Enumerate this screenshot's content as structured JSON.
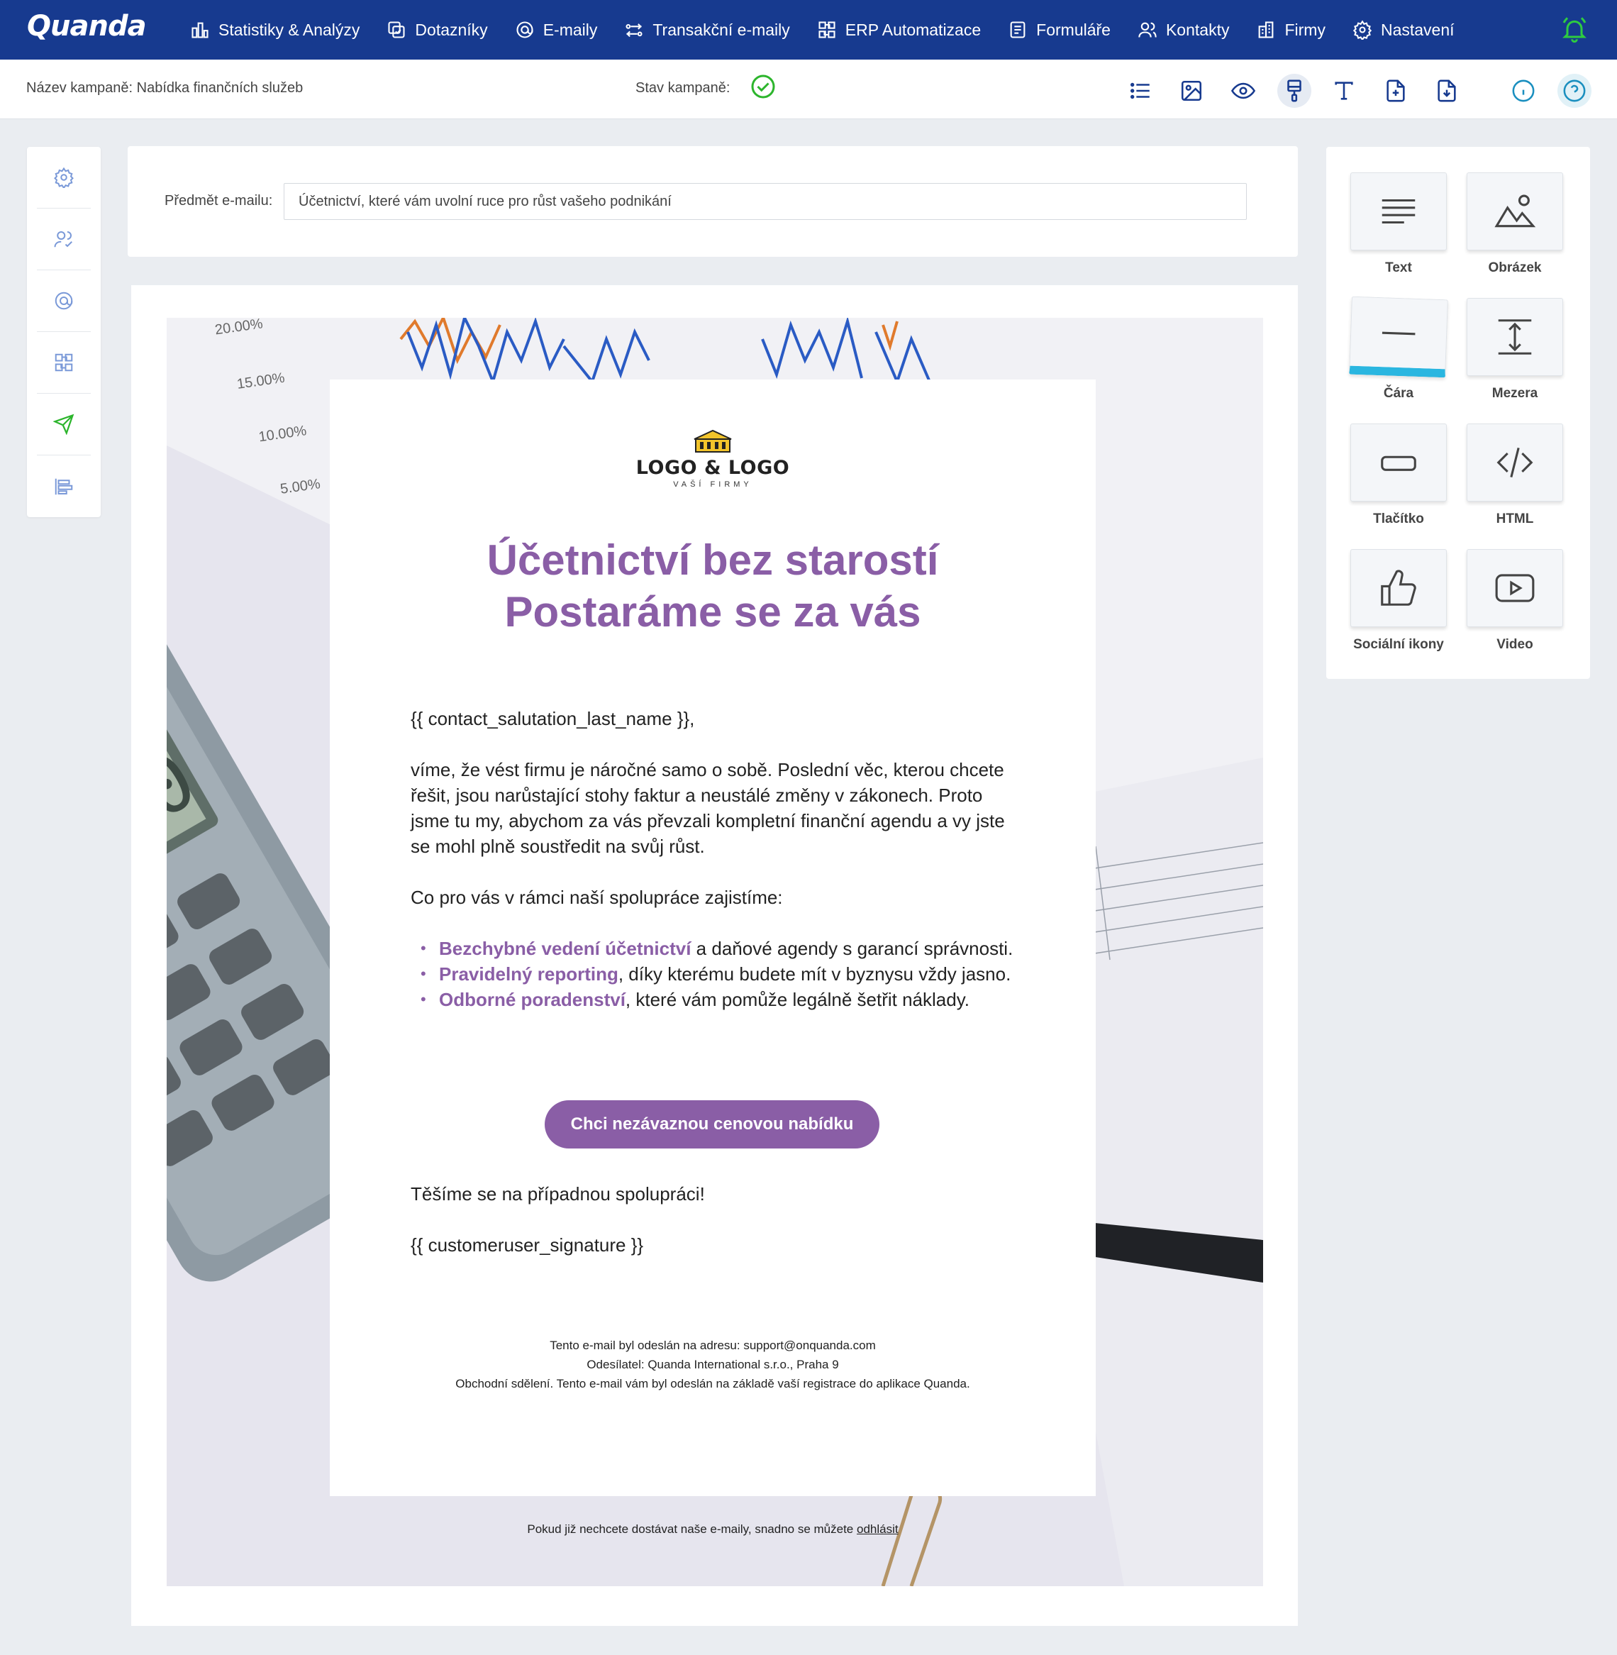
{
  "app": {
    "brand": "Quanda"
  },
  "nav": {
    "items": [
      {
        "label": "Statistiky & Analýzy",
        "icon": "bar-chart-icon"
      },
      {
        "label": "Dotazníky",
        "icon": "survey-icon"
      },
      {
        "label": "E-maily",
        "icon": "at-icon"
      },
      {
        "label": "Transakční e-maily",
        "icon": "transaction-icon"
      },
      {
        "label": "ERP Automatizace",
        "icon": "automation-icon"
      },
      {
        "label": "Formuláře",
        "icon": "form-icon"
      },
      {
        "label": "Kontakty",
        "icon": "contacts-icon"
      },
      {
        "label": "Firmy",
        "icon": "building-icon"
      },
      {
        "label": "Nastavení",
        "icon": "gear-icon"
      }
    ]
  },
  "campaign": {
    "name": "Název kampaně: Nabídka finančních služeb",
    "state_label": "Stav kampaně:",
    "state": "ok"
  },
  "subject": {
    "label": "Předmět e-mailu:",
    "value": "Účetnictví, které vám uvolní ruce pro růst vašeho podnikání"
  },
  "email": {
    "logo_name": "LOGO & LOGO",
    "logo_sub": "VAŠÍ FIRMY",
    "headline_1": "Účetnictví bez starostí",
    "headline_2": "Postaráme se za vás",
    "salutation": "{{ contact_salutation_last_name }},",
    "intro": "víme, že vést firmu je náročné samo o sobě. Poslední věc, kterou chcete řešit, jsou narůstající stohy faktur a neustálé změny v zákonech. Proto jsme tu my, abychom za vás převzali kompletní finanční agendu a vy jste se mohl plně soustředit na svůj růst.",
    "list_intro": "Co pro vás v rámci naší spolupráce zajistíme:",
    "bullets": [
      {
        "strong": "Bezchybné vedení účetnictví",
        "rest": " a daňové agendy s garancí správnosti."
      },
      {
        "strong": "Pravidelný reporting",
        "rest": ", díky kterému budete mít v byznysu vždy jasno."
      },
      {
        "strong": "Odborné poradenství",
        "rest": ", které vám pomůže legálně šetřit náklady."
      }
    ],
    "cta": "Chci nezávaznou cenovou nabídku",
    "closing": "Těšíme se na případnou spolupráci!",
    "signature": "{{ customeruser_signature }}",
    "footer_1": "Tento e-mail byl odeslán na adresu: support@onquanda.com",
    "footer_2": "Odesílatel: Quanda International s.r.o., Praha 9",
    "footer_3": "Obchodní sdělení. Tento e-mail vám byl odeslán na základě vaší registrace do aplikace Quanda.",
    "unsub_text": "Pokud již nechcete dostávat naše e-maily, snadno se můžete ",
    "unsub_link": "odhlásit"
  },
  "blocks": {
    "text": "Text",
    "image": "Obrázek",
    "line": "Čára",
    "spacer": "Mezera",
    "button": "Tlačítko",
    "html": "HTML",
    "social": "Sociální ikony",
    "video": "Video"
  },
  "colors": {
    "nav_bg": "#173a8f",
    "accent": "#8a5ea6",
    "ok_green": "#2cb52c",
    "drag_highlight": "#2ab6e0"
  }
}
